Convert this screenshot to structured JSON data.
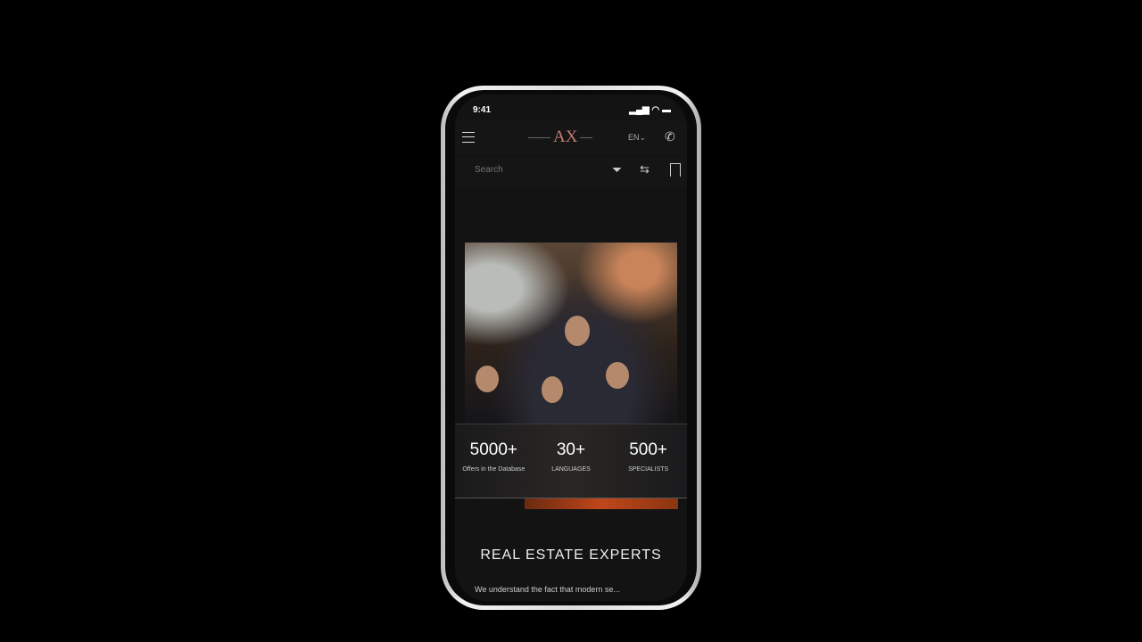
{
  "status": {
    "time": "9:41"
  },
  "header": {
    "logo": "AX",
    "language": "EN",
    "language_suffix": "⌄"
  },
  "search": {
    "placeholder": "Search"
  },
  "stats": [
    {
      "value": "5000+",
      "label": "Offers in the Database"
    },
    {
      "value": "30+",
      "label": "LANGUAGES"
    },
    {
      "value": "500+",
      "label": "SPECIALISTS"
    }
  ],
  "section": {
    "title": "REAL ESTATE EXPERTS",
    "text": "We understand the fact that modern se..."
  },
  "colors": {
    "accent": "#c0461a",
    "background": "#131314"
  }
}
